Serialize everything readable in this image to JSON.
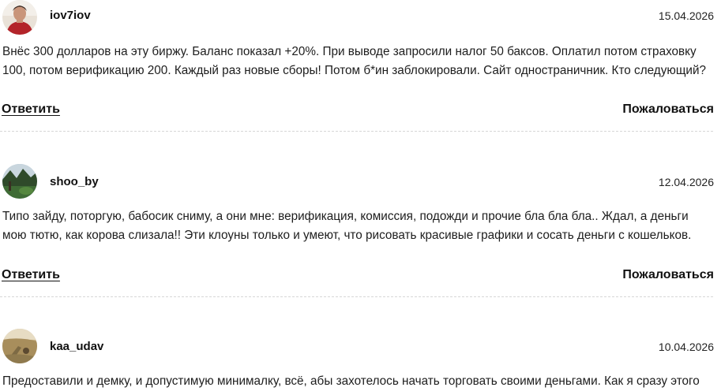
{
  "comments": [
    {
      "username": "iov7iov",
      "date": "15.04.2026",
      "avatar_icon": "user-photo-avatar",
      "text_lines": [
        "Внёс 300 долларов на эту биржу. Баланс показал +20%. При выводе запросили налог 50 баксов. Оплатил потом страховку",
        "100, потом верификацию 200. Каждый раз новые сборы! Потом б*ин заблокировали. Сайт одностраничник. Кто следующий?"
      ],
      "reply_label": "Ответить",
      "report_label": "Пожаловаться"
    },
    {
      "username": "shoo_by",
      "date": "12.04.2026",
      "avatar_icon": "landscape-photo-avatar",
      "text_lines": [
        "Типо зайду, поторгую, бабосик сниму, а они мне: верификация, комиссия, подожди и прочие бла бла бла.. Ждал, а деньги",
        "мою тютю, как корова слизала!! Эти клоуны только и умеют, что рисовать красивые графики и сосать деньги с кошельков."
      ],
      "reply_label": "Ответить",
      "report_label": "Пожаловаться"
    },
    {
      "username": "kaa_udav",
      "date": "10.04.2026",
      "avatar_icon": "field-photo-avatar",
      "text_lines": [
        "Предоставили и демку, и допустимую минималку, всё, абы захотелось начать торговать своими деньгами. Как я сразу этого"
      ],
      "reply_label": "",
      "report_label": ""
    }
  ]
}
